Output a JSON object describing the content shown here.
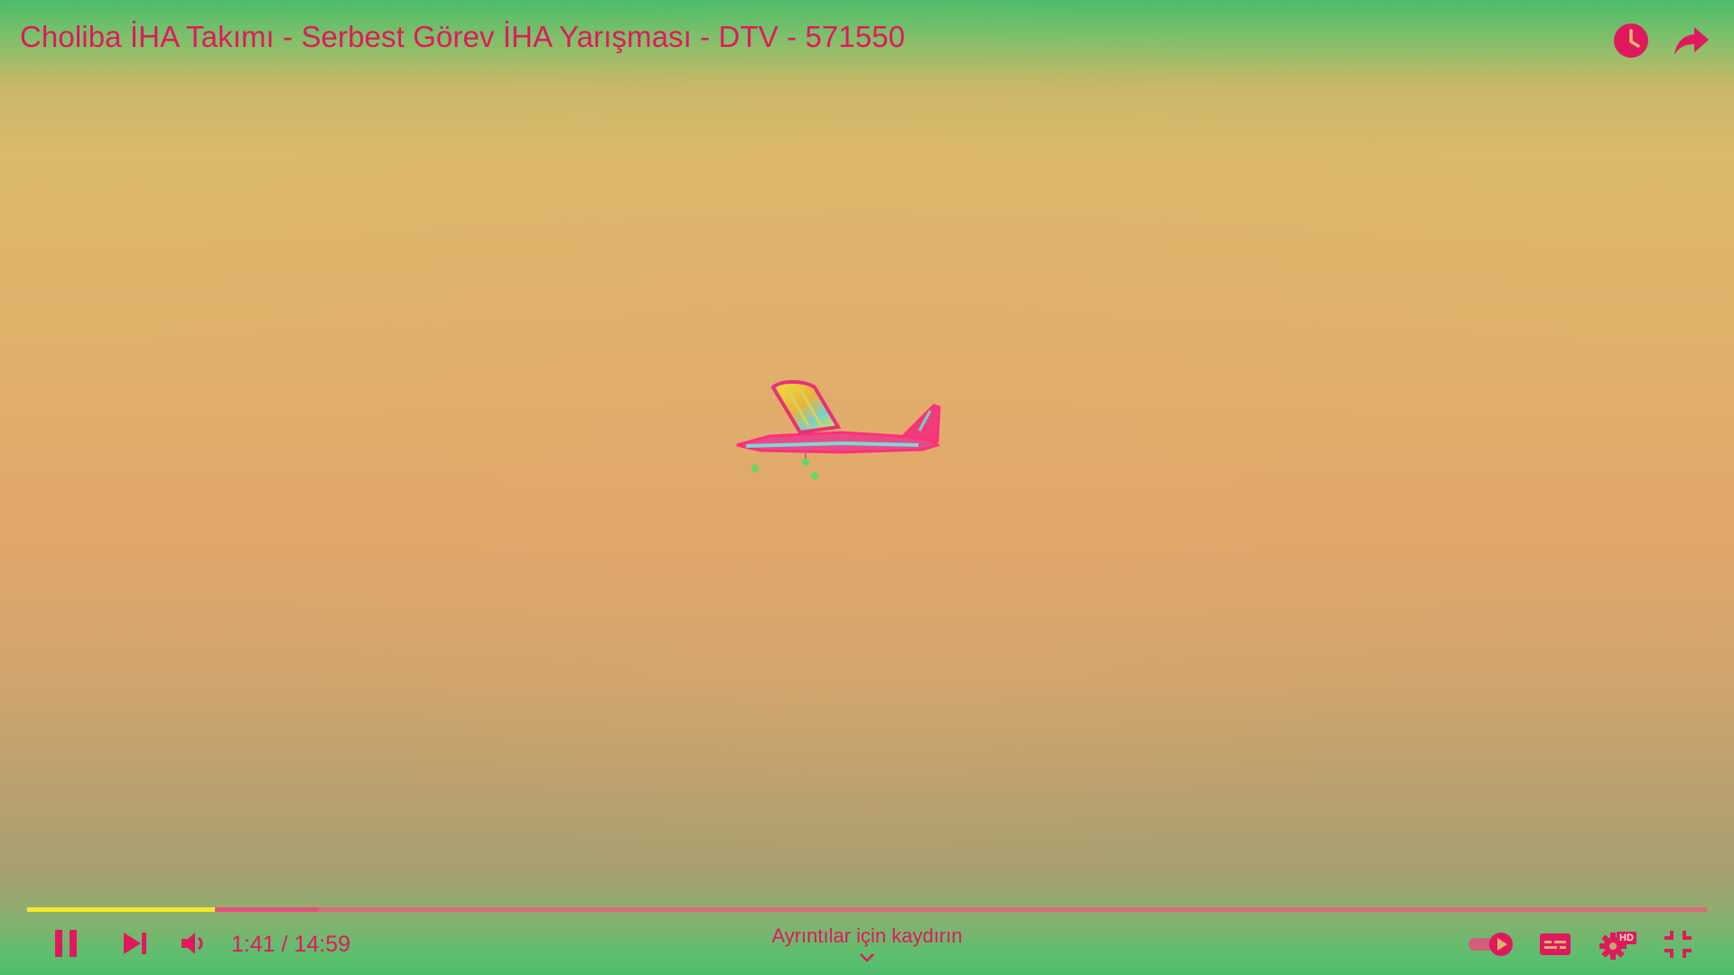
{
  "player": {
    "title": "Choliba İHA Takımı - Serbest Görev İHA Yarışması - DTV - 571550",
    "current_time": "1:41",
    "duration": "14:59",
    "time_display": "1:41 / 14:59",
    "progress_fraction": 0.112,
    "buffered_fraction": 0.173,
    "details_hint": "Ayrıntılar için kaydırın",
    "hd_badge": "HD",
    "autoplay_on": true
  },
  "icons": {
    "top_right": [
      "clock-icon",
      "share-icon"
    ],
    "controls_left": [
      "pause-icon",
      "next-icon",
      "volume-icon"
    ],
    "controls_right": [
      "autoplay-toggle",
      "subtitles-icon",
      "settings-icon",
      "exit-fullscreen-icon"
    ]
  },
  "colors": {
    "accent": "#e0195e",
    "progress_played": "#f2ea2a",
    "progress_buffered": "#e94d7e",
    "progress_track": "#d96a78"
  }
}
